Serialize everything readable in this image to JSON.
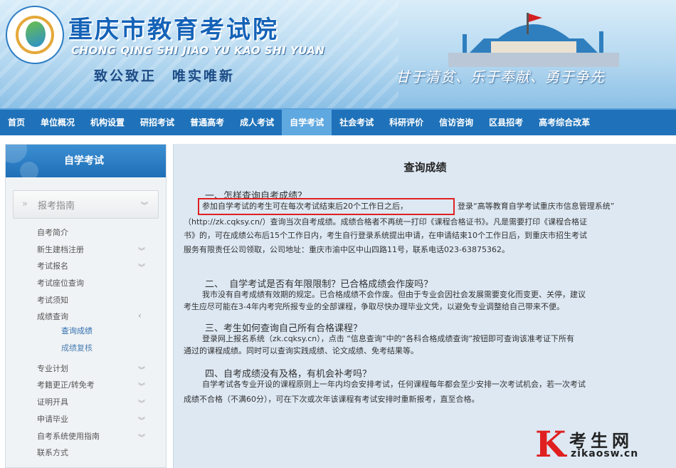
{
  "header": {
    "title": "重庆市教育考试院",
    "pinyin": "CHONG QING SHI JIAO YU KAO SHI YUAN",
    "motto_left": "致公致正　唯实唯新",
    "motto_right": "甘于清贫、乐于奉献、勇于争先"
  },
  "nav": {
    "items": [
      "首页",
      "单位概况",
      "机构设置",
      "研招考试",
      "普通高考",
      "成人考试",
      "自学考试",
      "社会考试",
      "科研评价",
      "信访咨询",
      "区县招考",
      "高考综合改革"
    ],
    "active_index": 6
  },
  "sidebar": {
    "header": "自学考试",
    "section_arrow": "»",
    "section_title": "报考指南",
    "items": [
      {
        "label": "自考简介"
      },
      {
        "label": "新生建档注册"
      },
      {
        "label": "考试报名"
      },
      {
        "label": "考试座位查询"
      },
      {
        "label": "考试须知"
      },
      {
        "label": "成绩查询"
      },
      {
        "label": "查询成绩"
      },
      {
        "label": "成绩复核"
      },
      {
        "label": "专业计划"
      },
      {
        "label": "考籍更正/转免考"
      },
      {
        "label": "证明开具"
      },
      {
        "label": "申请毕业"
      },
      {
        "label": "自考系统使用指南"
      },
      {
        "label": "联系方式"
      }
    ]
  },
  "content": {
    "title": "查询成绩",
    "q1": "一、怎样查询自考成绩？",
    "q1_highlight": "参加自学考试的考生可在每次考试结束后20个工作日之后，",
    "q1_line1_rest": "登录“高等教育自学考试重庆市信息管理系统”",
    "q1_line2": "（http://zk.cqksy.cn/）查询当次自考成绩。成绩合格者不再统一打印《课程合格证书》。凡是需要打印《课程合格证",
    "q1_line3": "书》的，可在成绩公布后15个工作日内，考生自行登录系统提出申请，在申请结束10个工作日后，到重庆市招生考试",
    "q1_line4": "服务有限责任公司领取，公司地址：重庆市渝中区中山四路11号，联系电话023-63875362。",
    "q2": "二、  自学考试是否有年限限制？已合格成绩会作废吗？",
    "q2_line1": "我市没有自考成绩有效期的规定。已合格成绩不会作废。但由于专业会因社会发展需要变化而变更、关停，建议",
    "q2_line2": "考生应尽可能在3-4年内考完所报专业的全部课程，争取尽快办理毕业文凭，以避免专业调整给自己带来不便。",
    "q3": "三、考生如何查询自己所有合格课程？",
    "q3_line1": "登录网上报名系统（zk.cqksy.cn），点击 “信息查询”中的“各科合格成绩查询”按钮即可查询该准考证下所有",
    "q3_line2": "通过的课程成绩。同时可以查询实践成绩、论文成绩、免考结果等。",
    "q4": "四、自考成绩没有及格，有机会补考吗？",
    "q4_line1": "自学考试各专业开设的课程原则上一年内均会安排考试，任何课程每年都会至少安排一次考试机会，若一次考试",
    "q4_line2": "成绩不合格（不满60分），可在下次或次年该课程有考试安排时重新报考，直至合格。"
  },
  "watermark": {
    "letter": "K",
    "cn": "考生网",
    "url": "zikaosw.cn"
  },
  "colors": {
    "nav_bg": "#1f72b9",
    "nav_active": "#5fa8e0",
    "content_bg": "#dde8f3",
    "highlight_border": "#e02020"
  }
}
